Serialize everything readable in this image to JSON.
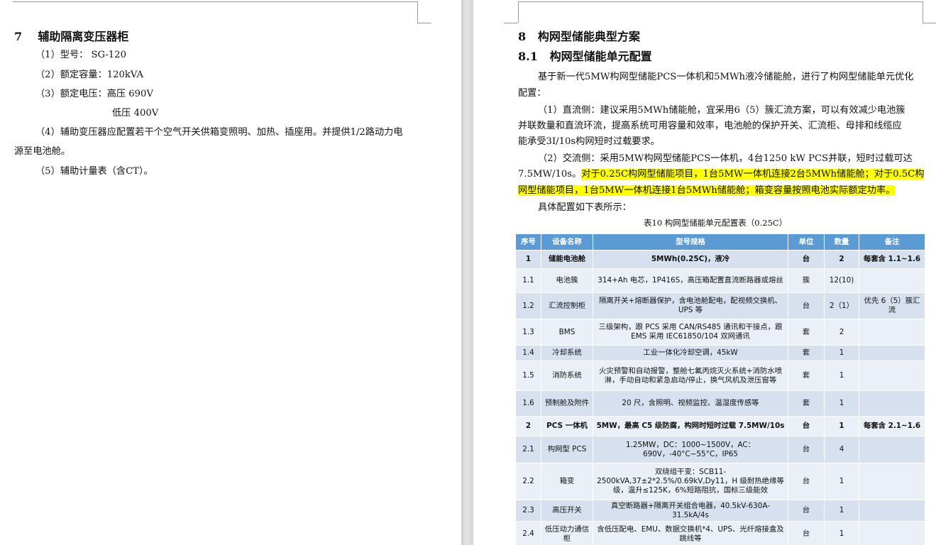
{
  "left_page": {
    "section7": {
      "number": "7",
      "title": "辅助隔离变压器柜",
      "items": [
        "（1）型号： SG-120",
        "（2）额定容量：120kVA",
        "（3）额定电压：高压 690V",
        "低压 400V",
        "（4）辅助变压器应配置若干个空气开关供箱变照明、加热、插座用。并提供1/2路动力电",
        "源至电池舱。",
        "（5）辅助计量表（含CT）。"
      ]
    }
  },
  "right_page": {
    "section8": {
      "number": "8",
      "title": "构网型储能典型方案"
    },
    "section81": {
      "number": "8.1",
      "title": "构网型储能单元配置"
    },
    "paragraphs": {
      "intro_l1": "基于新一代5MW构网型储能PCS一体机和5MWh液冷储能舱，进行了构网型储能单元优化",
      "intro_l2": "配置：",
      "dc_l1": "（1）直流侧：建议采用5MWh储能舱，宜采用6（5）簇汇流方案，可以有效减少电池簇",
      "dc_l2": "并联数量和直流环流，提高系统可用容量和效率，电池舱的保护开关、汇流柜、母排和线缆应",
      "dc_l3": "能承受3I/10s构网短时过载要求。",
      "ac_l1": "（2）交流侧：采用5MW构网型储能PCS一体机，4台1250 kW PCS并联，短时过载可达",
      "ac_l2_plain": "7.5MW/10s。",
      "ac_l2_hl": "对于0.25C构网型储能项目，1台5MW一体机连接2台5MWh储能舱；对于0.5C构",
      "ac_l3_hl": "网型储能项目，1台5MW一体机连接1台5MWh储能舱；箱变容量按照电池实际额定功率。",
      "detail": "具体配置如下表所示："
    },
    "table_caption": "表10   构网型储能单元配置表（0.25C）",
    "table": {
      "headers": [
        "序号",
        "设备名称",
        "型号规格",
        "单位",
        "数量",
        "备注"
      ],
      "rows": [
        [
          "1",
          "储能电池舱",
          "5MWh(0.25C)，液冷",
          "台",
          "2",
          "每套含 1.1~1.6"
        ],
        [
          "1.1",
          "电池簇",
          "314+Ah 电芯，1P416S，高压箱配置直流断路器或熔丝",
          "簇",
          "12(10)",
          ""
        ],
        [
          "1.2",
          "汇流控制柜",
          "隔离开关+熔断器保护，含电池舱配电，配视频交换机、UPS 等",
          "台",
          "2（1）",
          "优先 6（5）簇汇流"
        ],
        [
          "1.3",
          "BMS",
          "三级架构，跟 PCS 采用 CAN/RS485 通讯和干接点，跟 EMS 采用 IEC61850/104 双网通讯",
          "套",
          "2",
          ""
        ],
        [
          "1.4",
          "冷却系统",
          "工业一体化冷却空调，45kW",
          "套",
          "1",
          ""
        ],
        [
          "1.5",
          "消防系统",
          "火灾预警和自动报警，整舱七氟丙烷灭火系统+消防水喷淋，手动自动和紧急启动/停止，换气风机及泄压窗等",
          "套",
          "1",
          ""
        ],
        [
          "1.6",
          "预制舱及附件",
          "20 尺，含照明、视频监控、温湿度传感等",
          "套",
          "1",
          ""
        ],
        [
          "2",
          "PCS 一体机",
          "5MW，最高 C5 级防腐，构网时短时过载 7.5MW/10s",
          "台",
          "1",
          "每套含 2.1~1.6"
        ],
        [
          "2.1",
          "构网型 PCS",
          "1.25MW，DC：1000~1500V，AC：690V，-40°C~55°C，IP65",
          "台",
          "4",
          ""
        ],
        [
          "2.2",
          "箱变",
          "双绕组干变：SCB11-2500kVA,37±2*2.5%/0.69kV,Dy11，H 级耐热绝缘等级，温升≤125K，6%短路阻抗，国标三级能效",
          "台",
          "1",
          ""
        ],
        [
          "2.3",
          "高压开关",
          "真空断路器+隔离开关组合电器，40.5kV-630A-31.5kA/4s",
          "台",
          "1",
          ""
        ],
        [
          "2.4",
          "低压动力通信柜",
          "含低压配电、EMU、数据交换机*4、UPS、光纤熔接盒及跳线等",
          "台",
          "1",
          ""
        ]
      ]
    }
  }
}
